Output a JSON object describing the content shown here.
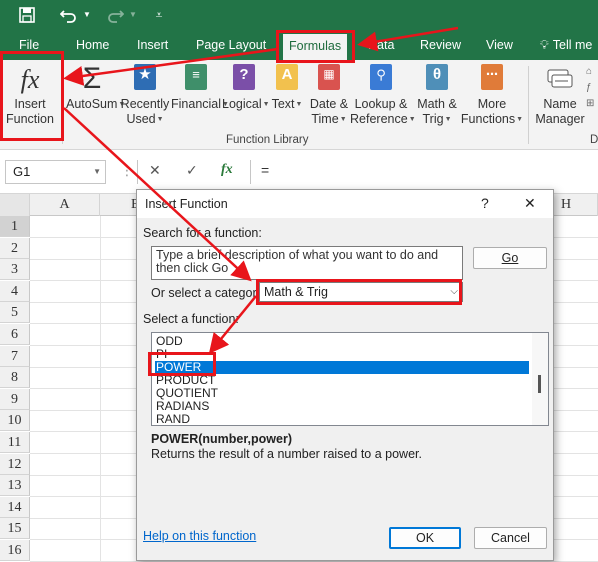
{
  "quick_access": {
    "save_icon": "save-icon",
    "undo_icon": "undo-icon",
    "redo_icon": "redo-icon",
    "customize_icon": "customize-qat-icon"
  },
  "tabs": [
    "File",
    "Home",
    "Insert",
    "Page Layout",
    "Formulas",
    "Data",
    "Review",
    "View"
  ],
  "tell_me": "Tell me",
  "ribbon": {
    "insert_function": {
      "line1": "Insert",
      "line2": "Function",
      "glyph": "fx"
    },
    "autosum": {
      "line1": "AutoSum",
      "glyph": "Σ"
    },
    "recently_used": {
      "line1": "Recently",
      "line2": "Used"
    },
    "financial": {
      "line1": "Financial"
    },
    "logical": {
      "line1": "Logical",
      "glyph": "?"
    },
    "text": {
      "line1": "Text",
      "glyph": "A"
    },
    "date_time": {
      "line1": "Date &",
      "line2": "Time"
    },
    "lookup": {
      "line1": "Lookup &",
      "line2": "Reference"
    },
    "math": {
      "line1": "Math &",
      "line2": "Trig",
      "glyph": "θ"
    },
    "more": {
      "line1": "More",
      "line2": "Functions"
    },
    "name_manager": {
      "line1": "Name",
      "line2": "Manager"
    },
    "group_label": "Function Library",
    "partial_group_label": "D"
  },
  "formula_bar": {
    "name_box": "G1",
    "cancel": "✕",
    "enter": "✓",
    "fx": "fx",
    "content": "="
  },
  "columns": [
    "A",
    "B",
    "H"
  ],
  "rows": [
    "1",
    "2",
    "3",
    "4",
    "5",
    "6",
    "7",
    "8",
    "9",
    "10",
    "11",
    "12",
    "13",
    "14",
    "15",
    "16"
  ],
  "dialog": {
    "title": "Insert Function",
    "help": "?",
    "close": "✕",
    "search_label": "Search for a function:",
    "search_text": "Type a brief description of what you want to do and then click Go",
    "go": "Go",
    "category_label": "Or select a category:",
    "category_value": "Math & Trig",
    "select_label": "Select a function:",
    "functions": [
      "ODD",
      "PI",
      "POWER",
      "PRODUCT",
      "QUOTIENT",
      "RADIANS",
      "RAND"
    ],
    "selected_function": "POWER",
    "syntax": "POWER(number,power)",
    "description": "Returns the result of a number raised to a power.",
    "help_link": "Help on this function",
    "ok": "OK",
    "cancel": "Cancel"
  },
  "colors": {
    "excel_green": "#227447",
    "annotation_red": "#e8151b",
    "selection_blue": "#0078d7"
  }
}
